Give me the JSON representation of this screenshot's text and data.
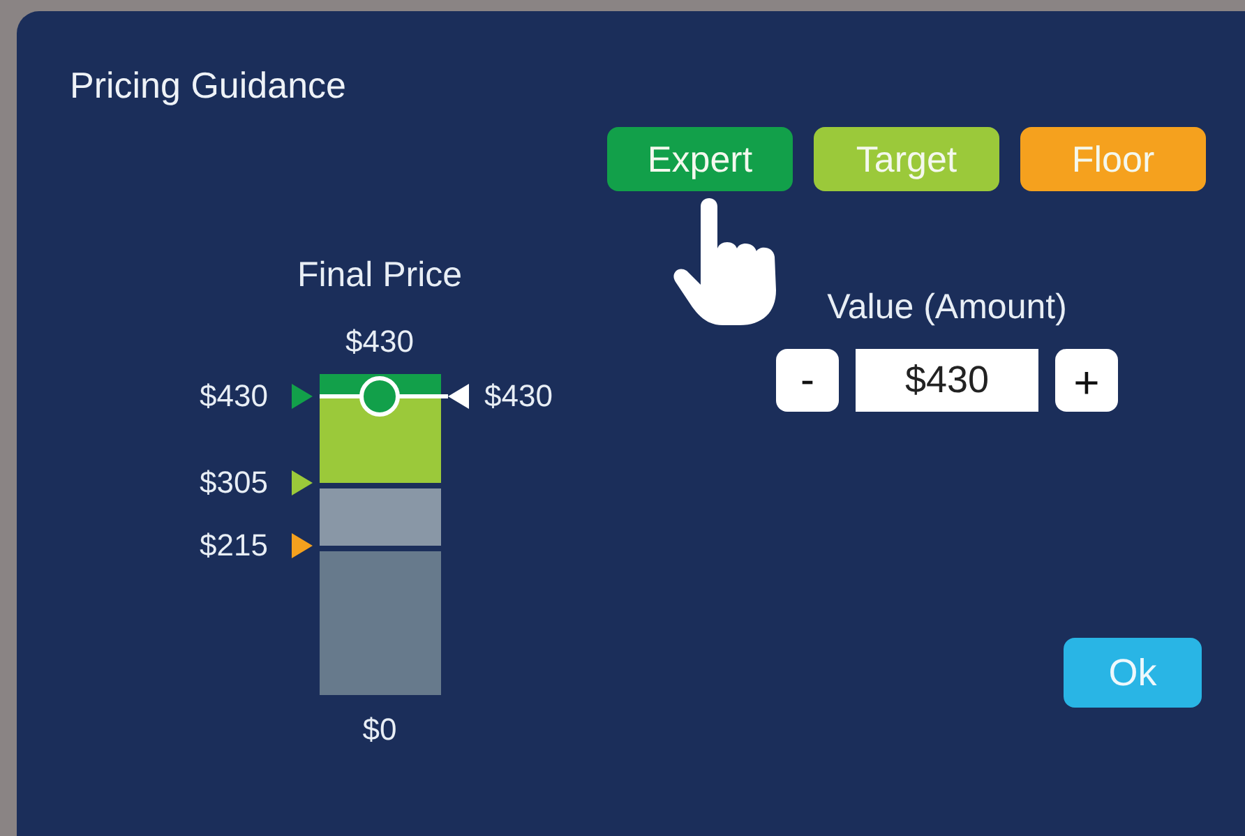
{
  "dialog": {
    "title": "Pricing Guidance"
  },
  "guidance_buttons": [
    {
      "label": "Expert",
      "color": "#12a04a"
    },
    {
      "label": "Target",
      "color": "#9bc93a"
    },
    {
      "label": "Floor",
      "color": "#f5a11e"
    }
  ],
  "final_price": {
    "title": "Final Price",
    "top_label": "$430",
    "bottom_label": "$0",
    "markers": [
      {
        "label": "$430",
        "color": "#12a04a"
      },
      {
        "label": "$305",
        "color": "#9bc93a"
      },
      {
        "label": "$215",
        "color": "#f5a11e"
      }
    ],
    "handle": {
      "label": "$430"
    }
  },
  "value": {
    "label": "Value (Amount)",
    "decrement": "-",
    "amount": "$430",
    "increment": "+"
  },
  "ok_button": "Ok"
}
